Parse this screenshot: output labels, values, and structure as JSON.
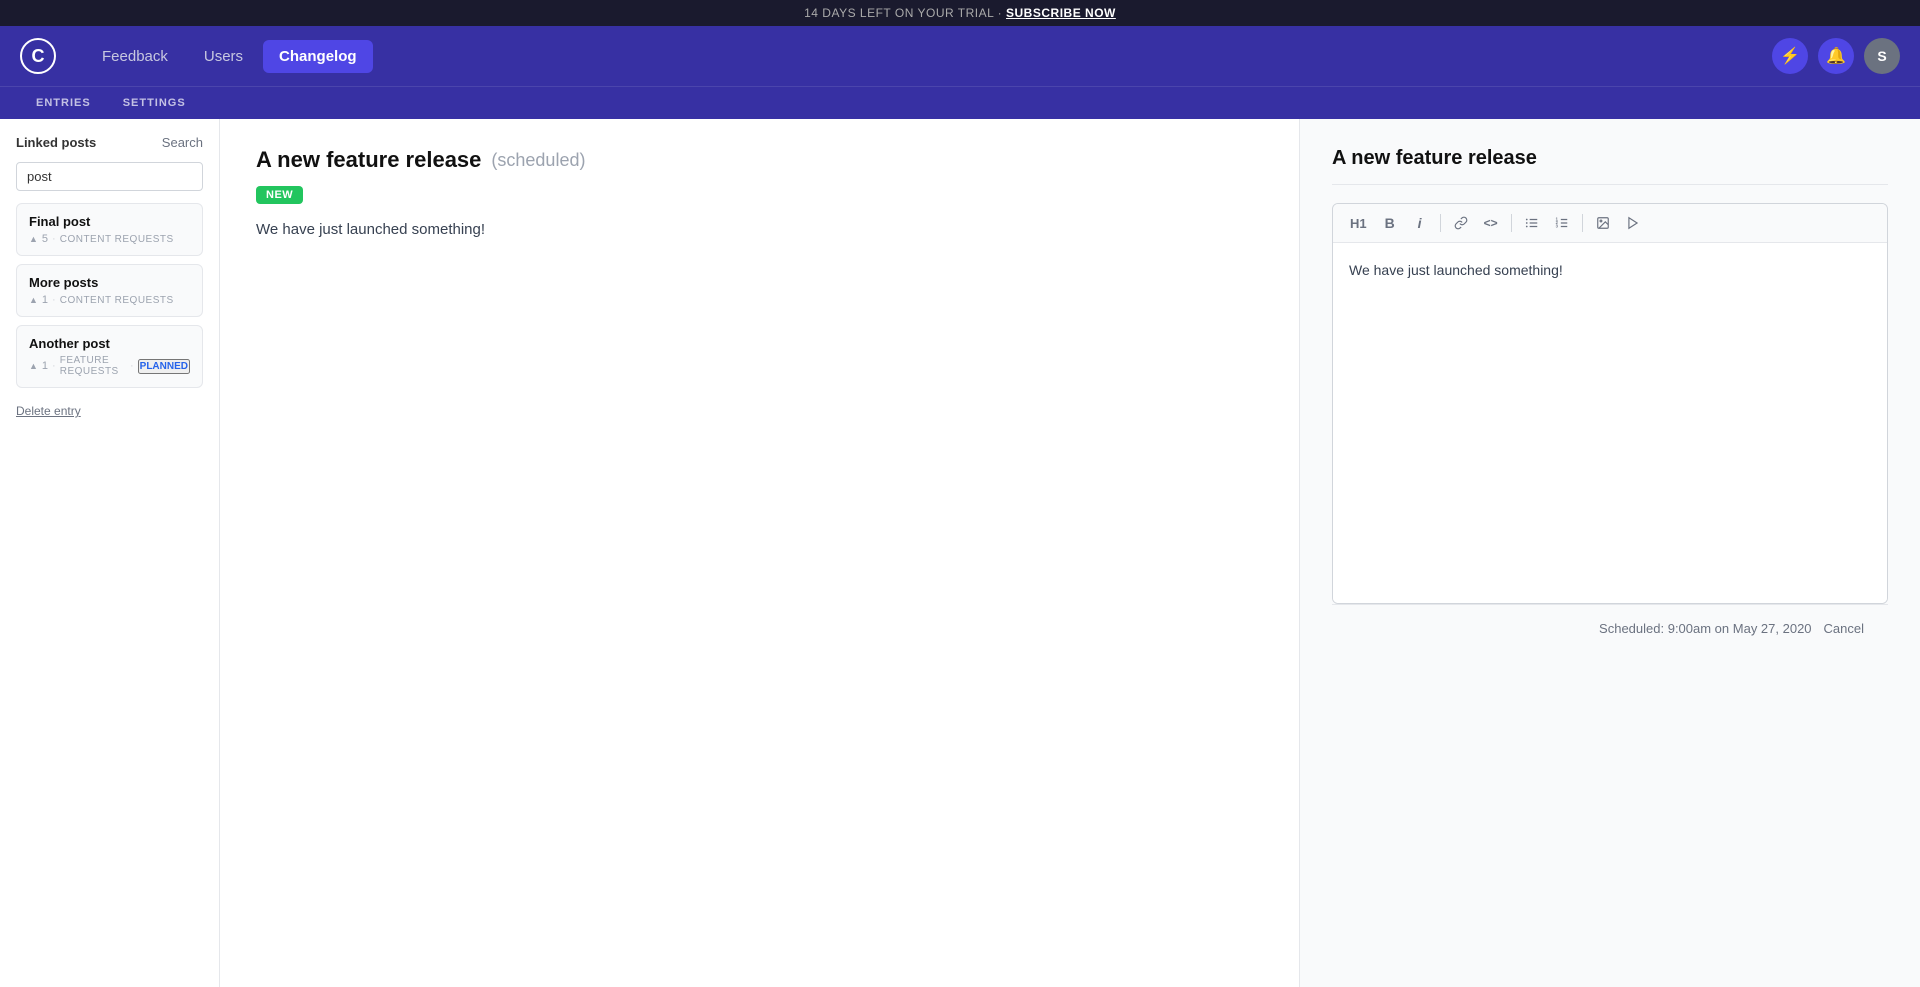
{
  "trial_banner": {
    "text": "14 DAYS LEFT ON YOUR TRIAL · ",
    "cta": "SUBSCRIBE NOW"
  },
  "nav": {
    "logo": "C",
    "links": [
      {
        "id": "feedback",
        "label": "Feedback",
        "active": false
      },
      {
        "id": "users",
        "label": "Users",
        "active": false
      },
      {
        "id": "changelog",
        "label": "Changelog",
        "active": true
      }
    ],
    "icons": {
      "lightning": "⚡",
      "bell": "🔔",
      "avatar": "S"
    }
  },
  "sub_nav": {
    "links": [
      {
        "id": "entries",
        "label": "ENTRIES"
      },
      {
        "id": "settings",
        "label": "SETTINGS"
      }
    ]
  },
  "sidebar": {
    "title": "Linked posts",
    "search_label": "Search",
    "search_placeholder": "post",
    "search_value": "post",
    "posts": [
      {
        "id": "final-post",
        "name": "Final post",
        "votes": "5",
        "category": "CONTENT REQUESTS",
        "status": null
      },
      {
        "id": "more-posts",
        "name": "More posts",
        "votes": "1",
        "category": "CONTENT REQUESTS",
        "status": null
      },
      {
        "id": "another-post",
        "name": "Another post",
        "votes": "1",
        "category": "FEATURE REQUESTS",
        "status": "PLANNED"
      }
    ],
    "delete_label": "Delete entry"
  },
  "center": {
    "title": "A new feature release",
    "scheduled_label": "(scheduled)",
    "badge": "NEW",
    "body": "We have just launched something!"
  },
  "editor": {
    "title": "A new feature release",
    "toolbar": {
      "buttons": [
        {
          "id": "h1",
          "label": "H1"
        },
        {
          "id": "bold",
          "label": "B"
        },
        {
          "id": "italic",
          "label": "i"
        },
        {
          "id": "link",
          "label": "🔗"
        },
        {
          "id": "code",
          "label": "<>"
        },
        {
          "id": "bullet-list",
          "label": "☰"
        },
        {
          "id": "ordered-list",
          "label": "≡"
        },
        {
          "id": "image",
          "label": "🖼"
        },
        {
          "id": "video",
          "label": "▶"
        }
      ]
    },
    "body": "We have just launched something!",
    "footer_scheduled": "Scheduled: 9:00am on May 27, 2020",
    "cancel_label": "Cancel"
  },
  "colors": {
    "nav_bg": "#3730a3",
    "active_btn": "#4f46e5",
    "badge_green": "#22c55e",
    "planned_blue": "#2563eb"
  }
}
